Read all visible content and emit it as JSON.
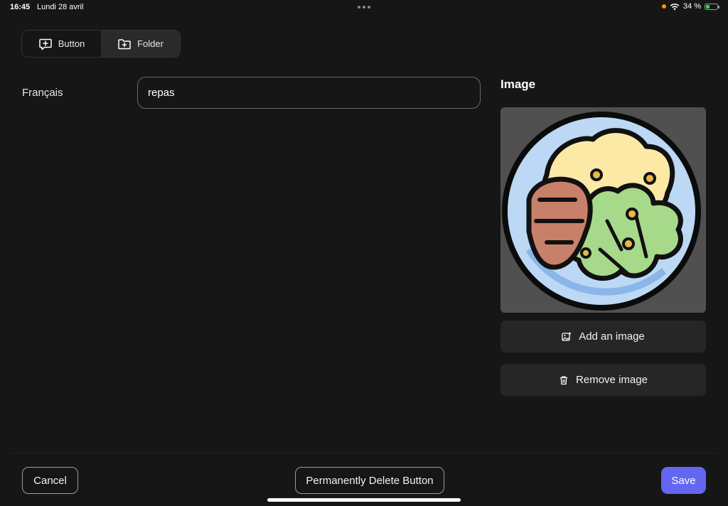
{
  "status_bar": {
    "time": "16:45",
    "date": "Lundi 28 avril",
    "battery_percent": "34 %",
    "battery_level": 0.34
  },
  "segment": {
    "items": [
      {
        "label": "Button",
        "icon": "speech-bubble-plus-icon",
        "selected": false
      },
      {
        "label": "Folder",
        "icon": "folder-plus-icon",
        "selected": true
      }
    ]
  },
  "form": {
    "language_label": "Français",
    "name_value": "repas"
  },
  "image_panel": {
    "heading": "Image",
    "image_alt": "meal plate illustration",
    "add_label": "Add an image",
    "remove_label": "Remove image"
  },
  "footer": {
    "cancel_label": "Cancel",
    "delete_label": "Permanently Delete Button",
    "save_label": "Save"
  },
  "colors": {
    "accent": "#6366f1",
    "background": "#161616",
    "button_bg": "#262626"
  }
}
